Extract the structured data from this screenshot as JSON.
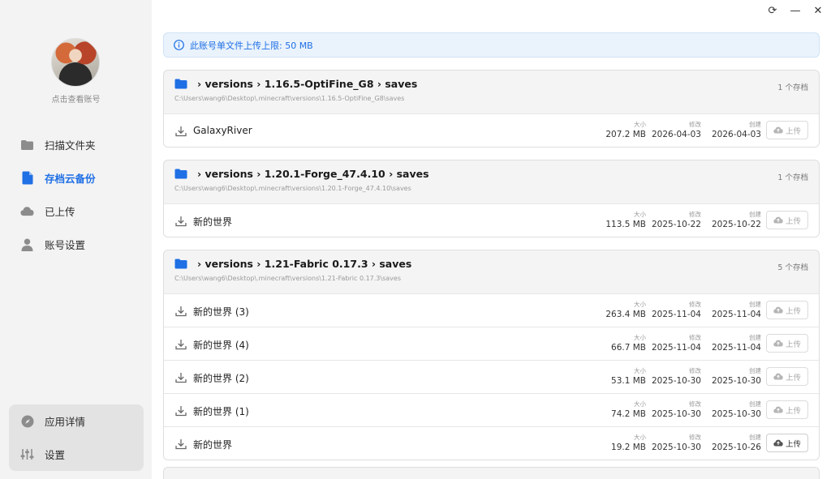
{
  "window": {
    "refresh": "⟳",
    "minimize": "—",
    "close": "✕"
  },
  "sidebar": {
    "account_caption": "点击查看账号",
    "items": [
      {
        "label": "扫描文件夹",
        "icon": "folder-icon"
      },
      {
        "label": "存档云备份",
        "icon": "file-icon",
        "active": true
      },
      {
        "label": "已上传",
        "icon": "cloud-icon"
      },
      {
        "label": "账号设置",
        "icon": "user-icon"
      }
    ],
    "bottom": [
      {
        "label": "应用详情",
        "icon": "compass-icon"
      },
      {
        "label": "设置",
        "icon": "sliders-icon"
      }
    ]
  },
  "notice": {
    "text": "此账号单文件上传上限: 50 MB"
  },
  "labels": {
    "size": "大小",
    "modified": "修改",
    "created": "创建",
    "upload": "上传"
  },
  "groups": [
    {
      "title": "› versions › 1.16.5-OptiFine_G8 › saves",
      "path": "C:\\Users\\wang6\\Desktop\\.minecraft\\versions\\1.16.5-OptiFine_G8\\saves",
      "count": "1 个存档",
      "rows": [
        {
          "name": "GalaxyRiver",
          "size": "207.2 MB",
          "modified": "2026-04-03",
          "created": "2026-04-03",
          "upload_enabled": false
        }
      ]
    },
    {
      "title": "› versions › 1.20.1-Forge_47.4.10 › saves",
      "path": "C:\\Users\\wang6\\Desktop\\.minecraft\\versions\\1.20.1-Forge_47.4.10\\saves",
      "count": "1 个存档",
      "rows": [
        {
          "name": "新的世界",
          "size": "113.5 MB",
          "modified": "2025-10-22",
          "created": "2025-10-22",
          "upload_enabled": false
        }
      ]
    },
    {
      "title": "› versions › 1.21-Fabric 0.17.3 › saves",
      "path": "C:\\Users\\wang6\\Desktop\\.minecraft\\versions\\1.21-Fabric 0.17.3\\saves",
      "count": "5 个存档",
      "rows": [
        {
          "name": "新的世界 (3)",
          "size": "263.4 MB",
          "modified": "2025-11-04",
          "created": "2025-11-04",
          "upload_enabled": false
        },
        {
          "name": "新的世界 (4)",
          "size": "66.7 MB",
          "modified": "2025-11-04",
          "created": "2025-11-04",
          "upload_enabled": false
        },
        {
          "name": "新的世界 (2)",
          "size": "53.1 MB",
          "modified": "2025-10-30",
          "created": "2025-10-30",
          "upload_enabled": false
        },
        {
          "name": "新的世界 (1)",
          "size": "74.2 MB",
          "modified": "2025-10-30",
          "created": "2025-10-30",
          "upload_enabled": false
        },
        {
          "name": "新的世界",
          "size": "19.2 MB",
          "modified": "2025-10-30",
          "created": "2025-10-26",
          "upload_enabled": true
        }
      ]
    }
  ],
  "colors": {
    "accent": "#1f6fe5",
    "sidebar_bg": "#f3f3f3",
    "notice_bg": "#eaf3fc"
  }
}
